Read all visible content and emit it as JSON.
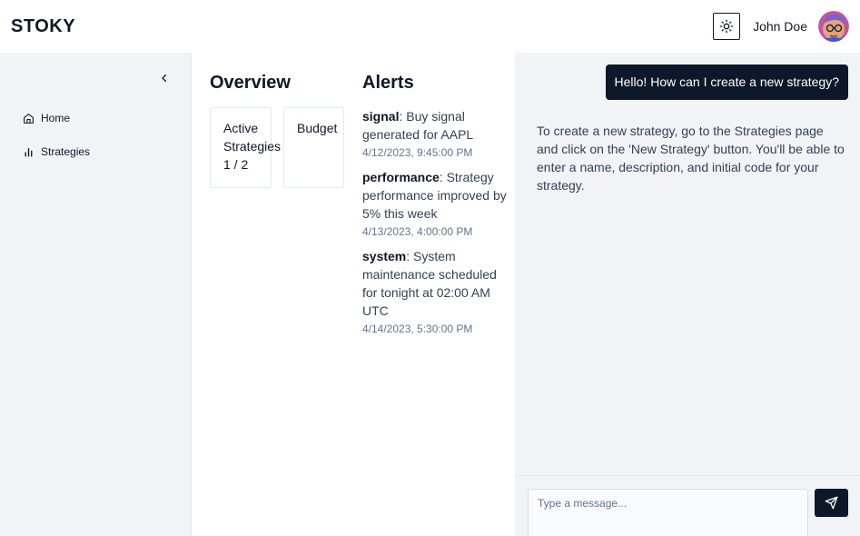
{
  "app": {
    "logo": "STOKY"
  },
  "header": {
    "user_name": "John Doe"
  },
  "sidebar": {
    "items": [
      {
        "label": "Home",
        "icon": "home-icon"
      },
      {
        "label": "Strategies",
        "icon": "bar-chart-icon"
      }
    ]
  },
  "overview": {
    "title": "Overview",
    "cards": [
      {
        "label": "Active Strategies",
        "value": "1 / 2"
      },
      {
        "label": "Budget",
        "value": ""
      }
    ]
  },
  "alerts": {
    "title": "Alerts",
    "items": [
      {
        "type": "signal",
        "message": ": Buy signal generated for AAPL",
        "time": "4/12/2023, 9:45:00 PM"
      },
      {
        "type": "performance",
        "message": ": Strategy performance improved by 5% this week",
        "time": "4/13/2023, 4:00:00 PM"
      },
      {
        "type": "system",
        "message": ": System maintenance scheduled for tonight at 02:00 AM UTC",
        "time": "4/14/2023, 5:30:00 PM"
      }
    ]
  },
  "chat": {
    "messages": [
      {
        "role": "user",
        "text": "Hello! How can I create a new strategy?"
      },
      {
        "role": "assistant",
        "text": "To create a new strategy, go to the Strategies page and click on the 'New Strategy' button. You'll be able to enter a name, description, and initial code for your strategy."
      }
    ],
    "input_placeholder": "Type a message...",
    "input_value": ""
  },
  "colors": {
    "primary": "#0f172a",
    "sidebar_bg": "#f1f3f7",
    "muted_text": "#64748b",
    "border": "#e2e8f0"
  }
}
